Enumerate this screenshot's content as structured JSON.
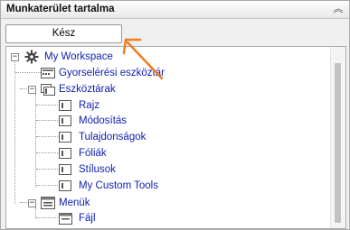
{
  "panel": {
    "title": "Munkaterület tartalma",
    "collapse_icon": "chevron-up-double-icon",
    "done_button": "Kész"
  },
  "tree": {
    "root": {
      "label": "My Workspace",
      "icon": "gear-icon",
      "expanded": true
    },
    "quick_access": {
      "label": "Gyorselérési eszköztár",
      "icon": "toolbar-icon"
    },
    "toolbars": {
      "label": "Eszköztárak",
      "icon": "toolbars-icon",
      "expanded": true,
      "items": [
        "Rajz",
        "Módosítás",
        "Tulajdonságok",
        "Fóliák",
        "Stílusok",
        "My Custom Tools"
      ]
    },
    "menus": {
      "label": "Menük",
      "icon": "menu-icon",
      "expanded": true,
      "items": [
        "Fájl"
      ]
    }
  },
  "annotation": {
    "arrow_color": "#f07d1e"
  }
}
